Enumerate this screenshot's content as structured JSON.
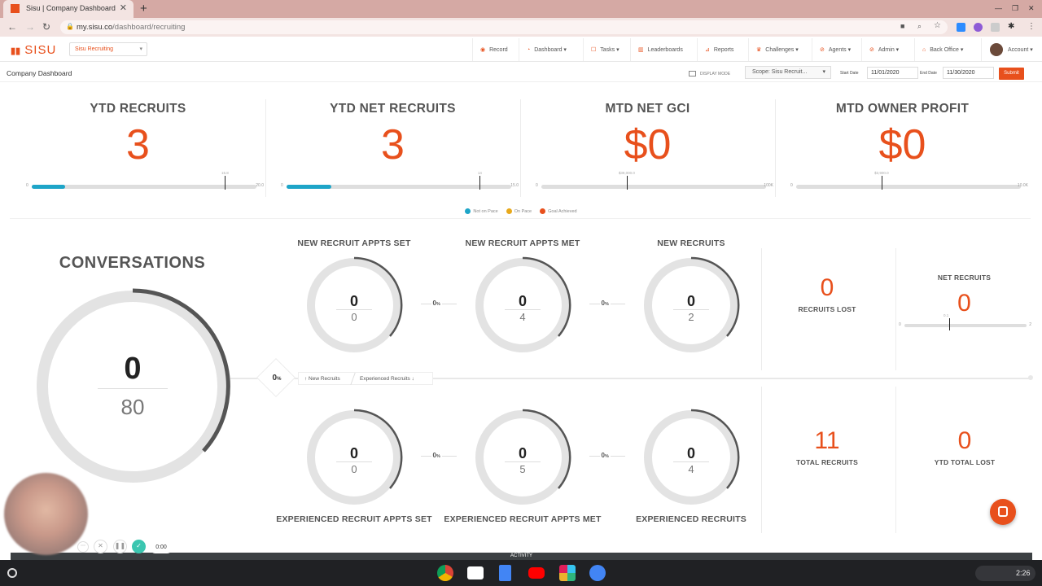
{
  "browser": {
    "tab_title": "Sisu | Company Dashboard",
    "url_host": "my.sisu.co",
    "url_path": "/dashboard/recruiting"
  },
  "app": {
    "logo": "SISU",
    "team_select": "Sisu Recruiting",
    "menu": [
      {
        "label": "Record",
        "icon": "record-icon"
      },
      {
        "label": "Dashboard ▾",
        "icon": "dashboard-icon"
      },
      {
        "label": "Tasks ▾",
        "icon": "tasks-icon"
      },
      {
        "label": "Leaderboards",
        "icon": "leaderboards-icon"
      },
      {
        "label": "Reports",
        "icon": "reports-icon"
      },
      {
        "label": "Challenges ▾",
        "icon": "challenges-icon"
      },
      {
        "label": "Agents ▾",
        "icon": "agents-icon"
      },
      {
        "label": "Admin ▾",
        "icon": "admin-icon"
      },
      {
        "label": "Back Office ▾",
        "icon": "back-office-icon"
      }
    ],
    "account": "Account ▾"
  },
  "toolbar": {
    "page_title": "Company Dashboard",
    "display_mode": "DISPLAY MODE",
    "scope": "Scope: Sisu Recruit...",
    "start_label": "Start Date",
    "start_value": "11/01/2020",
    "end_label": "End Date",
    "end_value": "11/30/2020",
    "submit": "Submit"
  },
  "kpis": [
    {
      "title": "YTD RECRUITS",
      "value": "3",
      "min": "0",
      "max": "20.0",
      "goal_label": "15.8",
      "progress_fraction": 0.15,
      "goal_fraction": 0.86
    },
    {
      "title": "YTD NET RECRUITS",
      "value": "3",
      "min": "0",
      "max": "15.0",
      "goal_label": "14",
      "progress_fraction": 0.2,
      "goal_fraction": 0.86
    },
    {
      "title": "MTD NET GCI",
      "value": "$0",
      "min": "0",
      "max": "100K",
      "goal_label": "$39,000.0",
      "progress_fraction": 0,
      "goal_fraction": 0.38
    },
    {
      "title": "MTD OWNER PROFIT",
      "value": "$0",
      "min": "0",
      "max": "10.0K",
      "goal_label": "$3,900.0",
      "progress_fraction": 0,
      "goal_fraction": 0.38
    }
  ],
  "legend": [
    {
      "label": "Not on Pace",
      "color": "#1ea5c8"
    },
    {
      "label": "On Pace",
      "color": "#e8a91c"
    },
    {
      "label": "Goal Achieved",
      "color": "#e8501c"
    }
  ],
  "conversations": {
    "title": "CONVERSATIONS",
    "value": "0",
    "goal": "80"
  },
  "funnel": {
    "center_pct": "0",
    "toggle_new": "↑ New Recruits",
    "toggle_exp": "Experienced Recruits ↓",
    "top": [
      {
        "label": "NEW RECRUIT APPTS SET",
        "value": "0",
        "goal": "0"
      },
      {
        "label": "NEW RECRUIT APPTS MET",
        "value": "0",
        "goal": "4"
      },
      {
        "label": "NEW RECRUITS",
        "value": "0",
        "goal": "2"
      }
    ],
    "top_pcts": [
      "0",
      "0"
    ],
    "bottom": [
      {
        "label": "EXPERIENCED RECRUIT APPTS SET",
        "value": "0",
        "goal": "0"
      },
      {
        "label": "EXPERIENCED RECRUIT APPTS MET",
        "value": "0",
        "goal": "5"
      },
      {
        "label": "EXPERIENCED RECRUITS",
        "value": "0",
        "goal": "4"
      }
    ],
    "bottom_pcts": [
      "0",
      "0"
    ],
    "pct_sign": "%"
  },
  "stats": {
    "recruits_lost": {
      "value": "0",
      "label": "RECRUITS LOST"
    },
    "net_recruits": {
      "title": "NET RECRUITS",
      "value": "0",
      "min": "0",
      "max": "2",
      "goal_label": "0.1",
      "goal_fraction": 0.37
    },
    "total_recruits": {
      "value": "11",
      "label": "TOTAL RECRUITS"
    },
    "ytd_total_lost": {
      "value": "0",
      "label": "YTD TOTAL LOST"
    }
  },
  "recorder": {
    "time": "0:00"
  },
  "activity": "ACTIVITY",
  "shelf": {
    "time": "2:26"
  }
}
